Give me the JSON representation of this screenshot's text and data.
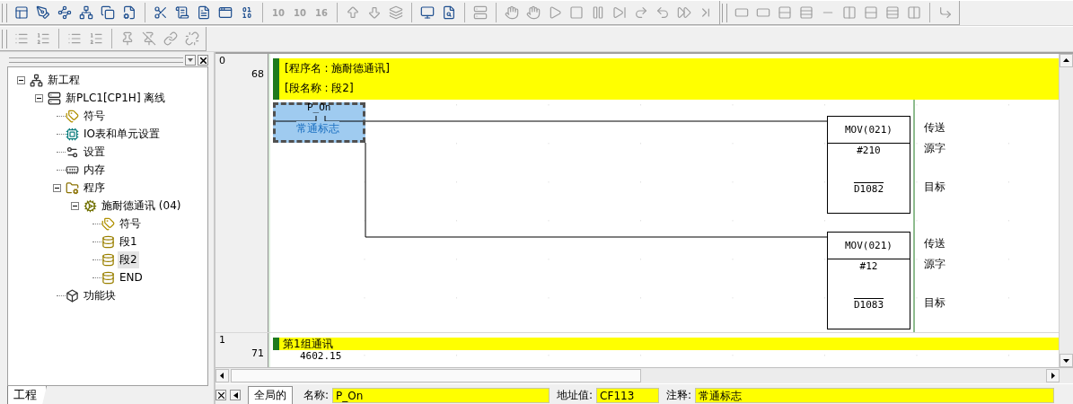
{
  "toolbar_rows": [
    [
      {
        "groups": [
          [
            {
              "disabled": false
            },
            {
              "disabled": false
            },
            {
              "disabled": false
            },
            {
              "disabled": false
            },
            {
              "disabled": false
            },
            {
              "disabled": false
            }
          ],
          [
            {
              "disabled": false
            },
            {
              "disabled": false
            },
            {
              "disabled": false
            },
            {
              "disabled": false
            },
            {
              "disabled": false
            }
          ],
          [
            {
              "label": "10",
              "disabled": true
            },
            {
              "label": "10",
              "disabled": true
            },
            {
              "label": "16",
              "disabled": true
            }
          ],
          [
            {
              "disabled": true
            },
            {
              "disabled": true
            },
            {
              "disabled": true
            }
          ],
          [
            {
              "disabled": false
            },
            {
              "disabled": false
            }
          ],
          [
            {
              "disabled": true
            }
          ],
          [
            {
              "disabled": true
            },
            {
              "disabled": true
            },
            {
              "disabled": true
            },
            {
              "disabled": true
            },
            {
              "disabled": true
            },
            {
              "disabled": true
            },
            {
              "disabled": true
            },
            {
              "disabled": true
            },
            {
              "disabled": true
            },
            {
              "disabled": true
            }
          ]
        ]
      },
      {
        "groups": [
          [
            {
              "disabled": true
            },
            {
              "disabled": true
            },
            {
              "disabled": true
            },
            {
              "disabled": true
            },
            {
              "disabled": true
            },
            {
              "disabled": true
            },
            {
              "disabled": true
            },
            {
              "disabled": true
            },
            {
              "disabled": true
            }
          ],
          [
            {
              "disabled": true
            }
          ]
        ]
      }
    ],
    [
      {
        "groups": [
          [
            {
              "disabled": true
            },
            {
              "disabled": true
            }
          ],
          [
            {
              "disabled": true
            },
            {
              "disabled": true
            }
          ],
          [
            {
              "disabled": true
            },
            {
              "disabled": true
            },
            {
              "disabled": true
            },
            {
              "disabled": true
            }
          ]
        ]
      }
    ]
  ],
  "project_panel": {
    "tab": "工程",
    "tree": [
      {
        "label": "新工程",
        "kind": "project",
        "expanded": true,
        "selected": false,
        "children": [
          {
            "label": "新PLC1[CP1H] 离线",
            "kind": "plc",
            "expanded": true,
            "selected": false,
            "children": [
              {
                "label": "符号",
                "kind": "symbols",
                "selected": false
              },
              {
                "label": "IO表和单元设置",
                "kind": "io",
                "selected": false
              },
              {
                "label": "设置",
                "kind": "settings",
                "selected": false
              },
              {
                "label": "内存",
                "kind": "memory",
                "selected": false
              },
              {
                "label": "程序",
                "kind": "program",
                "expanded": true,
                "selected": false,
                "children": [
                  {
                    "label": "施耐德通讯 (04)",
                    "kind": "task",
                    "expanded": true,
                    "selected": false,
                    "children": [
                      {
                        "label": "符号",
                        "kind": "symbols",
                        "selected": false
                      },
                      {
                        "label": "段1",
                        "kind": "section",
                        "selected": false
                      },
                      {
                        "label": "段2",
                        "kind": "section",
                        "selected": true
                      },
                      {
                        "label": "END",
                        "kind": "section",
                        "selected": false
                      }
                    ]
                  }
                ]
              },
              {
                "label": "功能块",
                "kind": "function-block",
                "selected": false
              }
            ]
          }
        ]
      }
    ]
  },
  "ladder": {
    "rungs": [
      {
        "number": "0",
        "step": "68",
        "comments": [
          "[程序名 : 施耐德通讯]",
          "[段名称 : 段2]"
        ],
        "contact": {
          "name": "P_On",
          "comment": "常通标志",
          "selected": true
        },
        "instructions": [
          {
            "mnemonic": "MOV(021)",
            "label": "传送",
            "operands": [
              {
                "value": "#210",
                "label": "源字",
                "overline": false
              },
              {
                "value": "D1082",
                "label": "目标",
                "overline": true
              }
            ]
          },
          {
            "mnemonic": "MOV(021)",
            "label": "传送",
            "operands": [
              {
                "value": "#12",
                "label": "源字",
                "overline": false
              },
              {
                "value": "D1083",
                "label": "目标",
                "overline": true
              }
            ]
          }
        ]
      },
      {
        "number": "1",
        "step": "71",
        "comments": [
          "第1组通讯"
        ],
        "contact": {
          "name": "4602.15"
        }
      }
    ]
  },
  "status_bar": {
    "tab": "全局的",
    "fields": [
      {
        "label": "名称:",
        "value": "P_On"
      },
      {
        "label": "地址值:",
        "value": "CF113"
      },
      {
        "label": "注释:",
        "value": "常通标志"
      }
    ]
  }
}
